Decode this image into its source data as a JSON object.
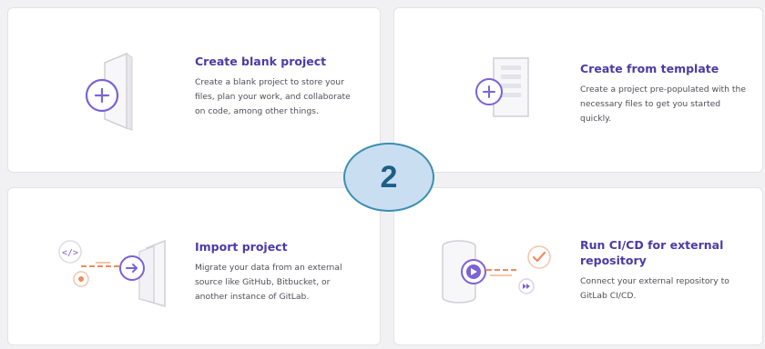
{
  "cards": [
    {
      "title": "Create blank project",
      "description": "Create a blank project to store your files, plan your work, and collaborate on code, among other things."
    },
    {
      "title": "Create from template",
      "description": "Create a project pre-populated with the necessary files to get you started quickly."
    },
    {
      "title": "Import project",
      "description": "Migrate your data from an external source like GitHub, Bitbucket, or another instance of GitLab."
    },
    {
      "title": "Run CI/CD for external repository",
      "description": "Connect your external repository to GitLab CI/CD."
    }
  ],
  "step_badge": "2",
  "colors": {
    "title": "#4b3ba6",
    "accent_purple": "#7b62d8",
    "accent_orange": "#f08c5c",
    "badge_fill": "#c9dff1",
    "badge_border": "#3b8fb1"
  },
  "icons": {
    "blank_project": "plus-circle-icon",
    "template": "plus-circle-icon",
    "import": "arrow-right-circle-icon",
    "cicd": "play-circle-icon"
  }
}
